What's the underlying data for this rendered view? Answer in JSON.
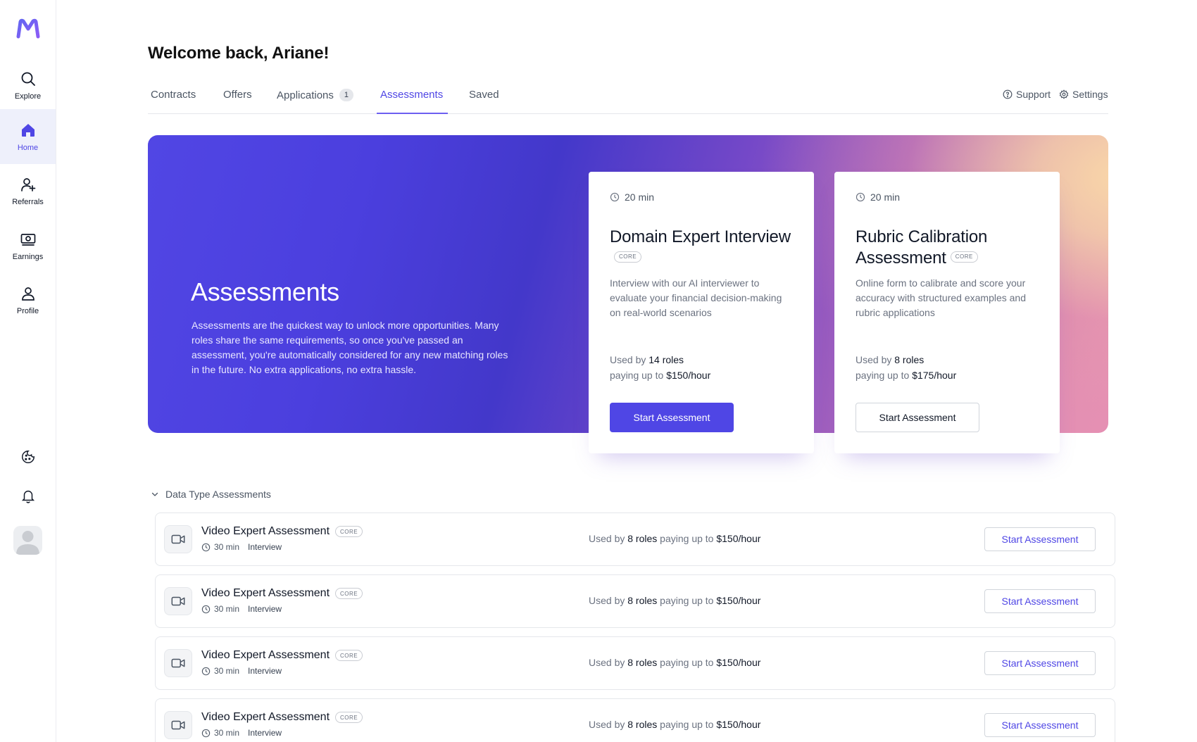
{
  "sidebar": {
    "logo_icon": "brand-m-logo",
    "items": [
      {
        "label": "Explore",
        "icon": "search-icon"
      },
      {
        "label": "Home",
        "icon": "home-icon",
        "active": true
      },
      {
        "label": "Referrals",
        "icon": "user-plus-icon"
      },
      {
        "label": "Earnings",
        "icon": "money-icon"
      },
      {
        "label": "Profile",
        "icon": "user-icon"
      }
    ],
    "bottom_icons": [
      "cookie-icon",
      "bell-icon",
      "avatar"
    ]
  },
  "header": {
    "welcome": "Welcome back, Ariane!"
  },
  "tabs": [
    {
      "label": "Contracts"
    },
    {
      "label": "Offers"
    },
    {
      "label": "Applications",
      "badge": "1"
    },
    {
      "label": "Assessments",
      "active": true
    },
    {
      "label": "Saved"
    }
  ],
  "top_links": {
    "support": "Support",
    "settings": "Settings"
  },
  "hero": {
    "title": "Assessments",
    "text": "Assessments are the quickest way to unlock more opportunities. Many roles share the same requirements, so once you've passed an assessment, you're automatically considered for any new matching roles in the future. No extra applications, no extra hassle."
  },
  "featured": [
    {
      "time": "20 min",
      "title": "Domain Expert Interview",
      "badge": "CORE",
      "description": "Interview with our AI interviewer to evaluate your financial decision-making on real-world scenarios",
      "used_by_prefix": "Used by",
      "roles": "14 roles",
      "paying_prefix": "paying up to",
      "rate": "$150/hour",
      "button": "Start Assessment",
      "button_style": "primary"
    },
    {
      "time": "20 min",
      "title": "Rubric Calibration Assessment",
      "badge": "CORE",
      "description": "Online form to calibrate and score your accuracy with structured examples and rubric applications",
      "used_by_prefix": "Used by",
      "roles": "8 roles",
      "paying_prefix": "paying up to",
      "rate": "$175/hour",
      "button": "Start Assessment",
      "button_style": "outline"
    }
  ],
  "section": {
    "title": "Data Type Assessments",
    "rows": [
      {
        "title": "Video Expert Assessment",
        "badge": "CORE",
        "time": "30 min",
        "type": "Interview",
        "used_by_prefix": "Used by",
        "roles": "8 roles",
        "paying_prefix": "paying up to",
        "rate": "$150/hour",
        "button": "Start Assessment"
      },
      {
        "title": "Video Expert Assessment",
        "badge": "CORE",
        "time": "30 min",
        "type": "Interview",
        "used_by_prefix": "Used by",
        "roles": "8 roles",
        "paying_prefix": "paying up to",
        "rate": "$150/hour",
        "button": "Start Assessment"
      },
      {
        "title": "Video Expert Assessment",
        "badge": "CORE",
        "time": "30 min",
        "type": "Interview",
        "used_by_prefix": "Used by",
        "roles": "8 roles",
        "paying_prefix": "paying up to",
        "rate": "$150/hour",
        "button": "Start Assessment"
      },
      {
        "title": "Video Expert Assessment",
        "badge": "CORE",
        "time": "30 min",
        "type": "Interview",
        "used_by_prefix": "Used by",
        "roles": "8 roles",
        "paying_prefix": "paying up to",
        "rate": "$150/hour",
        "button": "Start Assessment"
      }
    ]
  },
  "colors": {
    "accent": "#4f46e5",
    "hero_start": "#5146e4",
    "hero_end": "#f9d7a8"
  }
}
